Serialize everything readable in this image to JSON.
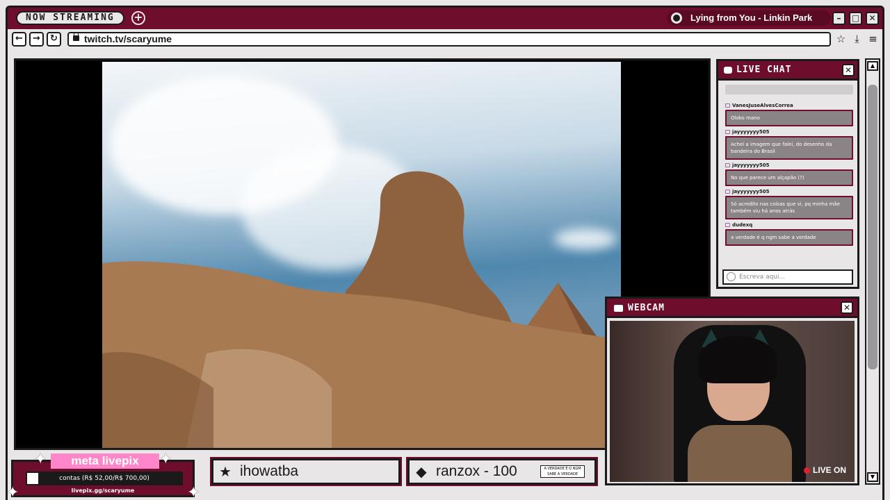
{
  "topbar": {
    "badge": "NOW STREAMING",
    "now_playing": "Lying from You - Linkin Park"
  },
  "browser": {
    "url": "twitch.tv/scaryume"
  },
  "chat": {
    "title": "LIVE CHAT",
    "input_placeholder": "Escreva aqui...",
    "messages": [
      {
        "user": "VanesJuseAlvesCorrea",
        "text": "Oloko mano"
      },
      {
        "user": "jayyyyyyy505",
        "text": "Achei a imagem que falei, do desenho da bandeira do Brasil"
      },
      {
        "user": "jayyyyyyy505",
        "text": "No que parece um alçapão (?)"
      },
      {
        "user": "jayyyyyyy505",
        "text": "Só acredito nas coisas que vi, pq minha mãe também viu há anos atrás"
      },
      {
        "user": "dudexq",
        "text": "a verdade é q ngm sabe a verdade"
      }
    ]
  },
  "webcam": {
    "title": "WEBCAM",
    "live_label": "LIVE ON"
  },
  "goal": {
    "title": "meta livepix",
    "progress_text": "contas (R$ 52,00/R$ 700,00)",
    "progress_fraction": 0.074,
    "url": "livepix.gg/scaryume"
  },
  "donors": [
    {
      "icon": "star-icon",
      "name": "ihowatba"
    },
    {
      "icon": "diamond-icon",
      "name": "ranzox - 100",
      "tag": "A VERDADE É Q NGM SABE A VERDADE"
    }
  ]
}
